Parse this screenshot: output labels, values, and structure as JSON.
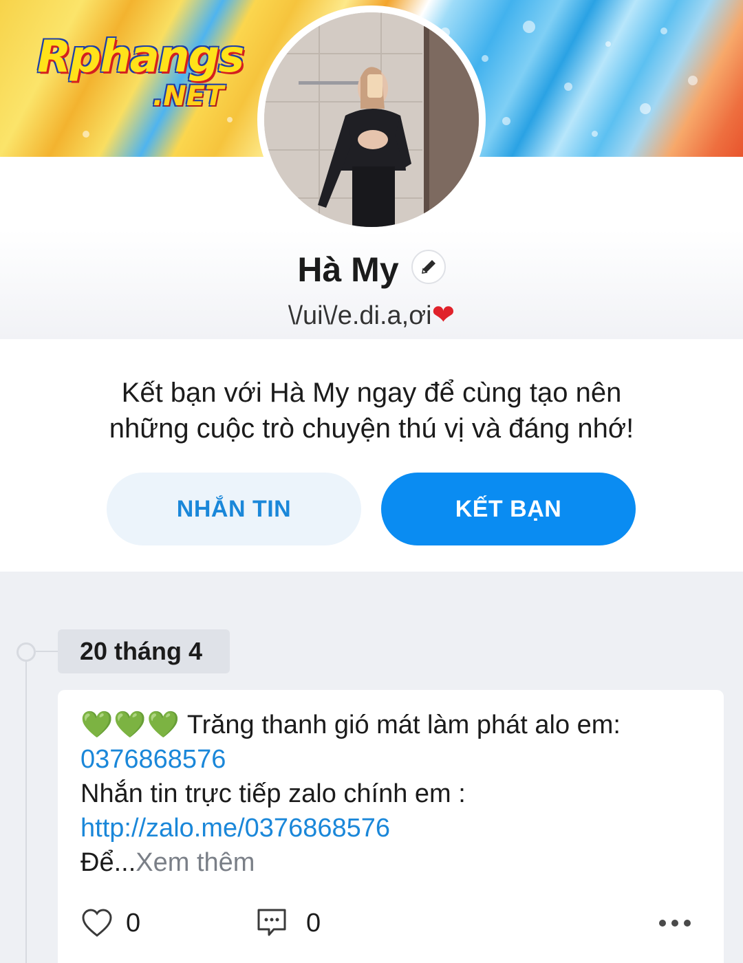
{
  "cover": {
    "logo_main": "Rphangs",
    "logo_sub": ".NET"
  },
  "profile": {
    "name": "Hà My",
    "status": "\\/ui\\/e.di.a,ơi",
    "status_emoji": "❤"
  },
  "friend": {
    "invite_line1": "Kết bạn với Hà My ngay để cùng tạo nên",
    "invite_line2": "những cuộc trò chuyện thú vị và đáng nhớ!",
    "message_button": "NHẮN TIN",
    "add_friend_button": "KẾT BẠN"
  },
  "timeline": {
    "date_label": "20 tháng 4",
    "post": {
      "emoji_prefix": "💚💚💚",
      "line1": " Trăng thanh gió mát làm phát alo em:",
      "phone_link": "0376868576",
      "line3": "Nhắn tin trực tiếp zalo chính em :",
      "url_link": "http://zalo.me/0376868576",
      "truncated": "Để...",
      "see_more": "Xem thêm",
      "like_count": "0",
      "comment_count": "0"
    }
  },
  "colors": {
    "accent_blue": "#0a8cf2",
    "link_blue": "#1a87d9",
    "secondary_button_bg": "#ecf4fb",
    "background": "#eef0f4"
  },
  "icons": [
    "edit-pencil-icon",
    "heart-outline-icon",
    "comment-icon",
    "more-dots-icon"
  ]
}
